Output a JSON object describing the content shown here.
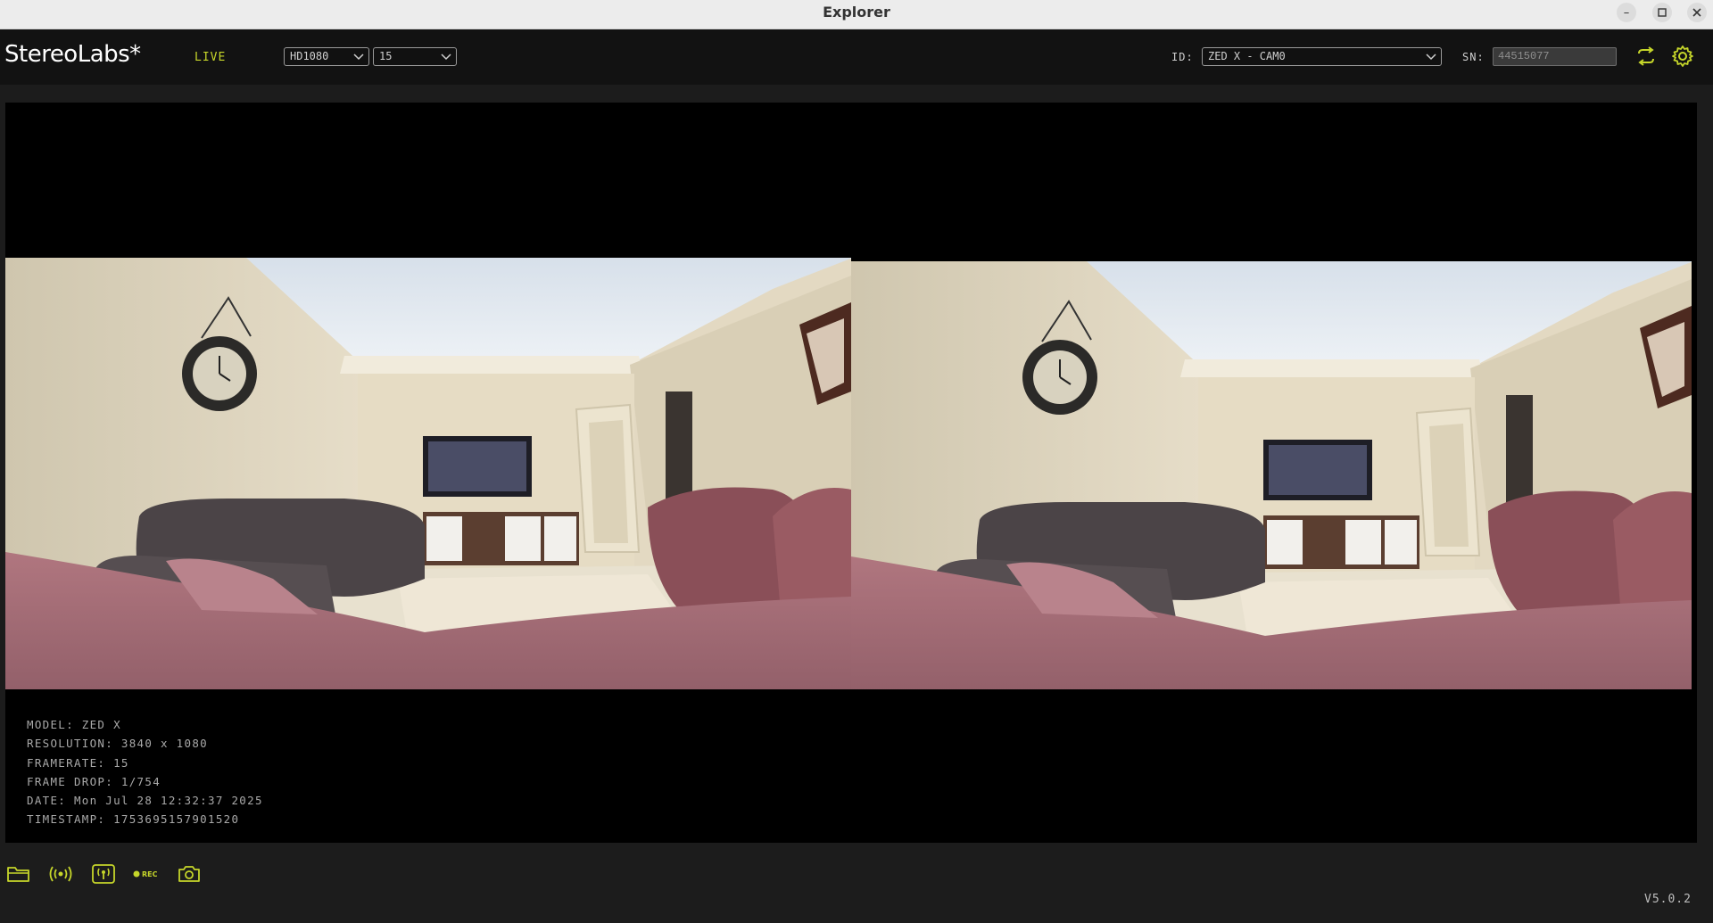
{
  "window": {
    "title": "Explorer",
    "controls": [
      "minimize-icon",
      "maximize-icon",
      "close-icon"
    ]
  },
  "toolbar": {
    "logo": "StereoLabs*",
    "status": "LIVE",
    "resolution_select": "HD1080",
    "fps_select": "15",
    "id_label": "ID:",
    "id_select": "ZED X - CAM0",
    "sn_label": "SN:",
    "sn_value": "44515077",
    "buttons": [
      "refresh-icon",
      "gear-icon"
    ]
  },
  "info": {
    "model": "MODEL: ZED X",
    "resolution": "RESOLUTION: 3840 x 1080",
    "framerate": "FRAMERATE: 15",
    "frame_drop": "FRAME DROP: 1/754",
    "date": "DATE: Mon Jul 28 12:32:37 2025",
    "timestamp": "TIMESTAMP: 1753695157901520"
  },
  "bottom_bar": {
    "rec_label": "REC",
    "version": "V5.0.2",
    "icons": [
      "folder-icon",
      "stream-icon",
      "streaming-device-icon",
      "record-icon",
      "camera-icon"
    ]
  },
  "colors": {
    "accent": "#c6d62a",
    "background": "#1c1c1c",
    "viewer_bg": "#000000"
  }
}
